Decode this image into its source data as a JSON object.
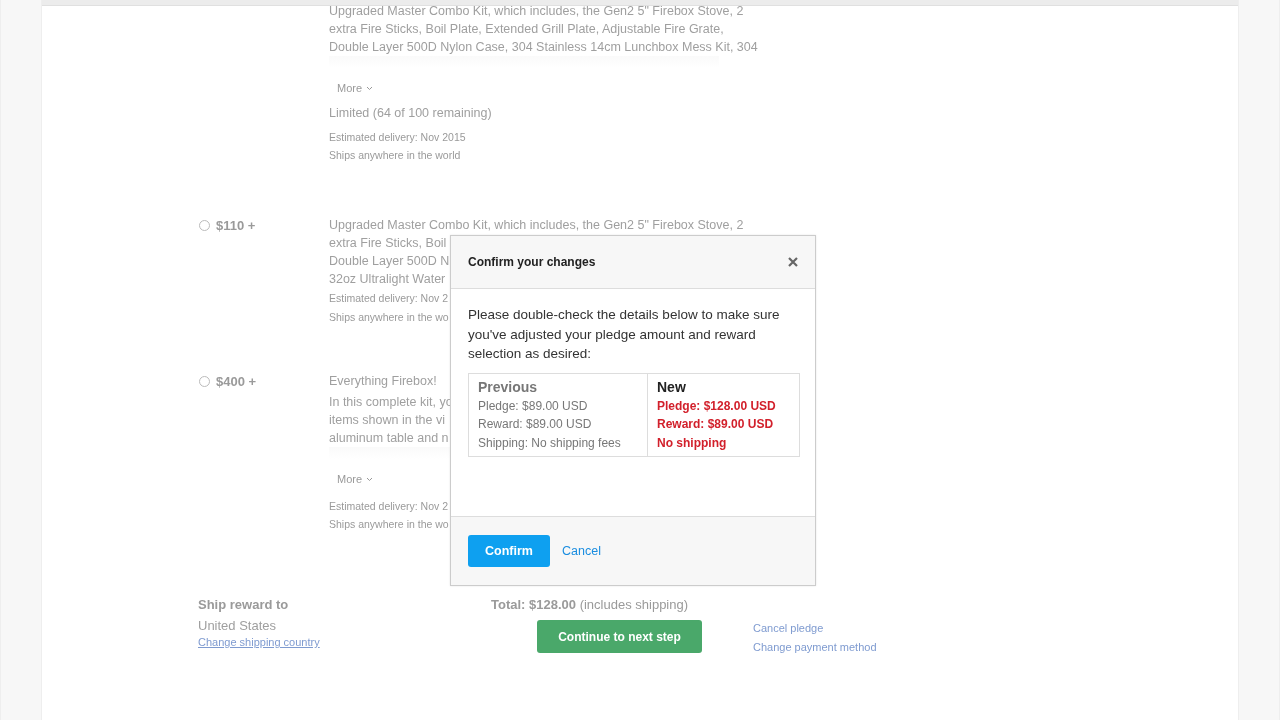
{
  "rewards": [
    {
      "lines": [
        "Upgraded Master Combo Kit, which includes, the Gen2 5\" Firebox Stove, 2",
        "extra Fire Sticks, Boil Plate, Extended Grill Plate, Adjustable Fire Grate,",
        "Double Layer 500D Nylon Case, 304 Stainless 14cm Lunchbox Mess Kit, 304"
      ],
      "more": "More",
      "limit": "Limited (64 of 100 remaining)",
      "delivery": "Estimated delivery: Nov 2015",
      "ships": "Ships anywhere in the world"
    },
    {
      "amount": "$110 +",
      "selected": false,
      "lines": [
        "Upgraded Master Combo Kit, which includes, the Gen2 5\" Firebox Stove, 2",
        "extra Fire Sticks, Boil",
        "Double Layer 500D N",
        "32oz Ultralight Water"
      ],
      "delivery": "Estimated delivery: Nov 2",
      "ships": "Ships anywhere in the wo"
    },
    {
      "amount": "$400 +",
      "selected": false,
      "title": "Everything Firebox!",
      "lines": [
        "In this complete kit, yo",
        "items shown in the vi",
        "aluminum table and n"
      ],
      "more": "More",
      "delivery": "Estimated delivery: Nov 2",
      "ships": "Ships anywhere in the wo"
    }
  ],
  "footer": {
    "ship_label": "Ship reward to",
    "country": "United States",
    "change_country": "Change shipping country",
    "total": "Total: $128.00",
    "total_note": "(includes shipping)",
    "continue": "Continue to next step",
    "cancel_pledge": "Cancel pledge",
    "change_payment": "Change payment method"
  },
  "modal": {
    "title": "Confirm your changes",
    "message": "Please double-check the details below to make sure you've adjusted your pledge amount and reward selection as desired:",
    "previous": {
      "heading": "Previous",
      "lines": [
        "Pledge: $89.00 USD",
        "Reward: $89.00 USD",
        "Shipping: No shipping fees"
      ]
    },
    "new": {
      "heading": "New",
      "lines": [
        "Pledge: $128.00 USD",
        "Reward: $89.00 USD",
        "No shipping"
      ]
    },
    "confirm": "Confirm",
    "cancel": "Cancel"
  }
}
